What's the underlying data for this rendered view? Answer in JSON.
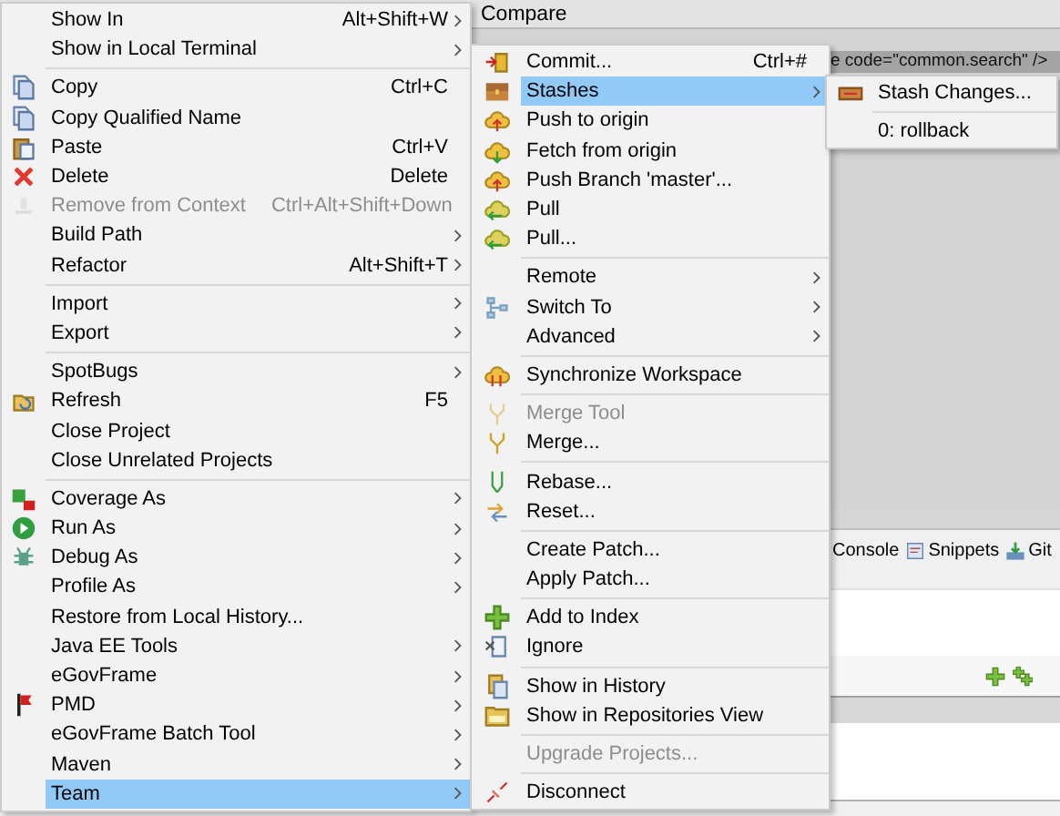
{
  "title_bar": {
    "label": "Compare"
  },
  "editor": {
    "code_line": "e code=\"common.search\" />"
  },
  "view_tabs": [
    {
      "label": "Console"
    },
    {
      "label": "Snippets"
    },
    {
      "label": "Git"
    }
  ],
  "context_menu": {
    "items": [
      {
        "kind": "item",
        "label": "Show In",
        "shortcut": "Alt+Shift+W",
        "submenu": true,
        "disabled": false,
        "selected": false
      },
      {
        "kind": "item",
        "label": "Show in Local Terminal",
        "submenu": true,
        "disabled": false,
        "selected": false
      },
      {
        "kind": "separator"
      },
      {
        "kind": "item",
        "label": "Copy",
        "shortcut": "Ctrl+C",
        "submenu": false,
        "disabled": false,
        "selected": false
      },
      {
        "kind": "item",
        "label": "Copy Qualified Name",
        "submenu": false,
        "disabled": false,
        "selected": false
      },
      {
        "kind": "item",
        "label": "Paste",
        "shortcut": "Ctrl+V",
        "submenu": false,
        "disabled": false,
        "selected": false
      },
      {
        "kind": "item",
        "label": "Delete",
        "shortcut": "Delete",
        "submenu": false,
        "disabled": false,
        "selected": false
      },
      {
        "kind": "item",
        "label": "Remove from Context",
        "shortcut": "Ctrl+Alt+Shift+Down",
        "submenu": false,
        "disabled": true,
        "selected": false
      },
      {
        "kind": "item",
        "label": "Build Path",
        "submenu": true,
        "disabled": false,
        "selected": false
      },
      {
        "kind": "item",
        "label": "Refactor",
        "shortcut": "Alt+Shift+T",
        "submenu": true,
        "disabled": false,
        "selected": false
      },
      {
        "kind": "separator"
      },
      {
        "kind": "item",
        "label": "Import",
        "submenu": true,
        "disabled": false,
        "selected": false
      },
      {
        "kind": "item",
        "label": "Export",
        "submenu": true,
        "disabled": false,
        "selected": false
      },
      {
        "kind": "separator"
      },
      {
        "kind": "item",
        "label": "SpotBugs",
        "submenu": true,
        "disabled": false,
        "selected": false
      },
      {
        "kind": "item",
        "label": "Refresh",
        "shortcut": "F5",
        "submenu": false,
        "disabled": false,
        "selected": false
      },
      {
        "kind": "item",
        "label": "Close Project",
        "submenu": false,
        "disabled": false,
        "selected": false
      },
      {
        "kind": "item",
        "label": "Close Unrelated Projects",
        "submenu": false,
        "disabled": false,
        "selected": false
      },
      {
        "kind": "separator"
      },
      {
        "kind": "item",
        "label": "Coverage As",
        "submenu": true,
        "disabled": false,
        "selected": false
      },
      {
        "kind": "item",
        "label": "Run As",
        "submenu": true,
        "disabled": false,
        "selected": false
      },
      {
        "kind": "item",
        "label": "Debug As",
        "submenu": true,
        "disabled": false,
        "selected": false
      },
      {
        "kind": "item",
        "label": "Profile As",
        "submenu": true,
        "disabled": false,
        "selected": false
      },
      {
        "kind": "item",
        "label": "Restore from Local History...",
        "submenu": false,
        "disabled": false,
        "selected": false
      },
      {
        "kind": "item",
        "label": "Java EE Tools",
        "submenu": true,
        "disabled": false,
        "selected": false
      },
      {
        "kind": "item",
        "label": "eGovFrame",
        "submenu": true,
        "disabled": false,
        "selected": false
      },
      {
        "kind": "item",
        "label": "PMD",
        "submenu": true,
        "disabled": false,
        "selected": false
      },
      {
        "kind": "item",
        "label": "eGovFrame Batch Tool",
        "submenu": true,
        "disabled": false,
        "selected": false
      },
      {
        "kind": "item",
        "label": "Maven",
        "submenu": true,
        "disabled": false,
        "selected": false
      },
      {
        "kind": "item",
        "label": "Team",
        "submenu": true,
        "disabled": false,
        "selected": true
      }
    ]
  },
  "team_menu": {
    "items": [
      {
        "kind": "item",
        "label": "Commit...",
        "shortcut": "Ctrl+#",
        "submenu": false,
        "disabled": false,
        "selected": false
      },
      {
        "kind": "item",
        "label": "Stashes",
        "submenu": true,
        "disabled": false,
        "selected": true
      },
      {
        "kind": "item",
        "label": "Push to origin",
        "submenu": false,
        "disabled": false,
        "selected": false
      },
      {
        "kind": "item",
        "label": "Fetch from origin",
        "submenu": false,
        "disabled": false,
        "selected": false
      },
      {
        "kind": "item",
        "label": "Push Branch 'master'...",
        "submenu": false,
        "disabled": false,
        "selected": false
      },
      {
        "kind": "item",
        "label": "Pull",
        "submenu": false,
        "disabled": false,
        "selected": false
      },
      {
        "kind": "item",
        "label": "Pull...",
        "submenu": false,
        "disabled": false,
        "selected": false
      },
      {
        "kind": "separator"
      },
      {
        "kind": "item",
        "label": "Remote",
        "submenu": true,
        "disabled": false,
        "selected": false
      },
      {
        "kind": "item",
        "label": "Switch To",
        "submenu": true,
        "disabled": false,
        "selected": false
      },
      {
        "kind": "item",
        "label": "Advanced",
        "submenu": true,
        "disabled": false,
        "selected": false
      },
      {
        "kind": "separator"
      },
      {
        "kind": "item",
        "label": "Synchronize Workspace",
        "submenu": false,
        "disabled": false,
        "selected": false
      },
      {
        "kind": "separator"
      },
      {
        "kind": "item",
        "label": "Merge Tool",
        "submenu": false,
        "disabled": true,
        "selected": false
      },
      {
        "kind": "item",
        "label": "Merge...",
        "submenu": false,
        "disabled": false,
        "selected": false
      },
      {
        "kind": "separator"
      },
      {
        "kind": "item",
        "label": "Rebase...",
        "submenu": false,
        "disabled": false,
        "selected": false
      },
      {
        "kind": "item",
        "label": "Reset...",
        "submenu": false,
        "disabled": false,
        "selected": false
      },
      {
        "kind": "separator"
      },
      {
        "kind": "item",
        "label": "Create Patch...",
        "submenu": false,
        "disabled": false,
        "selected": false
      },
      {
        "kind": "item",
        "label": "Apply Patch...",
        "submenu": false,
        "disabled": false,
        "selected": false
      },
      {
        "kind": "separator"
      },
      {
        "kind": "item",
        "label": "Add to Index",
        "submenu": false,
        "disabled": false,
        "selected": false
      },
      {
        "kind": "item",
        "label": "Ignore",
        "submenu": false,
        "disabled": false,
        "selected": false
      },
      {
        "kind": "separator"
      },
      {
        "kind": "item",
        "label": "Show in History",
        "submenu": false,
        "disabled": false,
        "selected": false
      },
      {
        "kind": "item",
        "label": "Show in Repositories View",
        "submenu": false,
        "disabled": false,
        "selected": false
      },
      {
        "kind": "separator"
      },
      {
        "kind": "item",
        "label": "Upgrade Projects...",
        "submenu": false,
        "disabled": true,
        "selected": false
      },
      {
        "kind": "separator"
      },
      {
        "kind": "item",
        "label": "Disconnect",
        "submenu": false,
        "disabled": false,
        "selected": false
      }
    ]
  },
  "stashes_menu": {
    "items": [
      {
        "kind": "item",
        "label": "Stash Changes...",
        "submenu": false,
        "disabled": false,
        "selected": false
      },
      {
        "kind": "separator"
      },
      {
        "kind": "item",
        "label": "0: rollback",
        "submenu": false,
        "disabled": false,
        "selected": false
      }
    ]
  }
}
